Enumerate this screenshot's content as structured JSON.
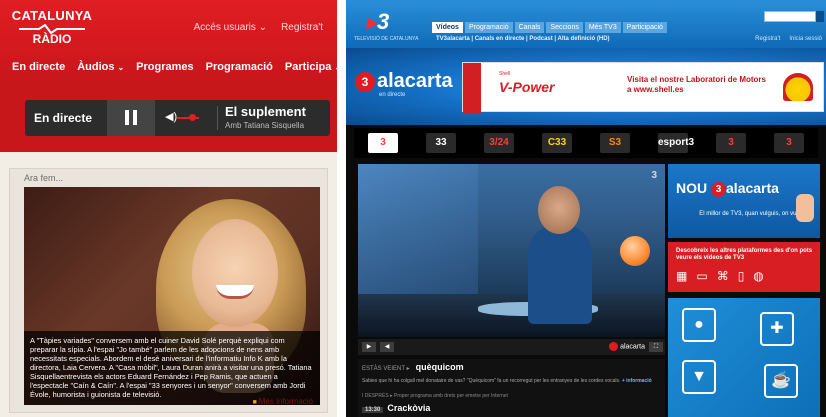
{
  "left": {
    "logo": {
      "line1": "CATALUNYA",
      "line2": "RÀDIO"
    },
    "top_links": [
      "Accés usuaris",
      "Registra't"
    ],
    "nav": [
      {
        "label": "En directe",
        "chevron": false
      },
      {
        "label": "Àudios",
        "chevron": true
      },
      {
        "label": "Programes",
        "chevron": false
      },
      {
        "label": "Programació",
        "chevron": false
      },
      {
        "label": "Participa",
        "chevron": true
      }
    ],
    "player": {
      "live_label": "En directe",
      "show_title": "El suplement",
      "host": "Amb Tatiana Sisquella"
    },
    "box": {
      "title": "Ara fem...",
      "caption": "A \"Tàpies variades\" conversem amb el cuiner David Solé perquè expliqui com preparar la sípia. A l'espai \"Jo també\" parlem de les adopcions de nens amb necessitats especials. Abordem el desè aniversari de l'informatiu Info K amb la directora, Laia Cervera. A \"Casa mòbil\", Laura Duran anirà a visitar una presó. Tatiana Sisquellaentrevista els actors Eduard Fernández i Pep Ramis, que actuen a l'espectacle \"Caín & Caín\". A l'espai \"33 senyores i un senyor\" conversem amb Jordi Évole, humorista i guionista de televisió.",
      "more": "Més informació"
    }
  },
  "right": {
    "logo": "3",
    "logo_sub": "TELEVISIÓ DE CATALUNYA",
    "tabs": [
      {
        "label": "Vídeos",
        "active": true
      },
      {
        "label": "Programació",
        "active": false
      },
      {
        "label": "Canals",
        "active": false
      },
      {
        "label": "Seccions",
        "active": false
      },
      {
        "label": "Més TV3",
        "active": false
      },
      {
        "label": "Participació",
        "active": false
      }
    ],
    "subnav": "TV3alacarta | Canals en directe | Podcast | Alta definició (HD)",
    "account_links": [
      "Registra't",
      "Inicia sessió"
    ],
    "alacarta": {
      "mark": "3",
      "word": "alacarta",
      "sub": "en directe"
    },
    "ad": {
      "brand_small": "Shell",
      "product": "V-Power",
      "text": "Visita el nostre Laboratori de Motors a www.shell.es"
    },
    "channels": [
      {
        "label": "3",
        "active": true,
        "tone": "red"
      },
      {
        "label": "33",
        "active": false,
        "tone": ""
      },
      {
        "label": "3/24",
        "active": false,
        "tone": "red"
      },
      {
        "label": "C33",
        "active": false,
        "tone": "yellow"
      },
      {
        "label": "S3",
        "active": false,
        "tone": "orange"
      },
      {
        "label": "esport3",
        "active": false,
        "tone": ""
      },
      {
        "label": "3",
        "active": false,
        "tone": "red"
      },
      {
        "label": "3",
        "active": false,
        "tone": "red"
      }
    ],
    "video": {
      "watermark": "3"
    },
    "controls": {
      "logo_word": "alacarta"
    },
    "info": {
      "label": "ESTÀS VEIENT",
      "title": "quèquicom",
      "desc": "Sabies que hi ha colgall mel donataire de vas? \"Quèquicom\" fa un recorregut per les entranyes de les cordes vocals.",
      "desc_link": "+ informació",
      "next_label": "I DESPRÉS",
      "next_note": "Proper programa amb drets per emetre per Internet",
      "now_time": "13:30",
      "now_title": "Crackòvia"
    },
    "promo1": {
      "nou": "NOU",
      "mark": "3",
      "word": "alacarta",
      "sub": "El millor de TV3, quan vulguis, on vulguis"
    },
    "promo2": {
      "text": "Descobreix les altres plataformes des d'on pots veure els vídeos de TV3"
    }
  }
}
